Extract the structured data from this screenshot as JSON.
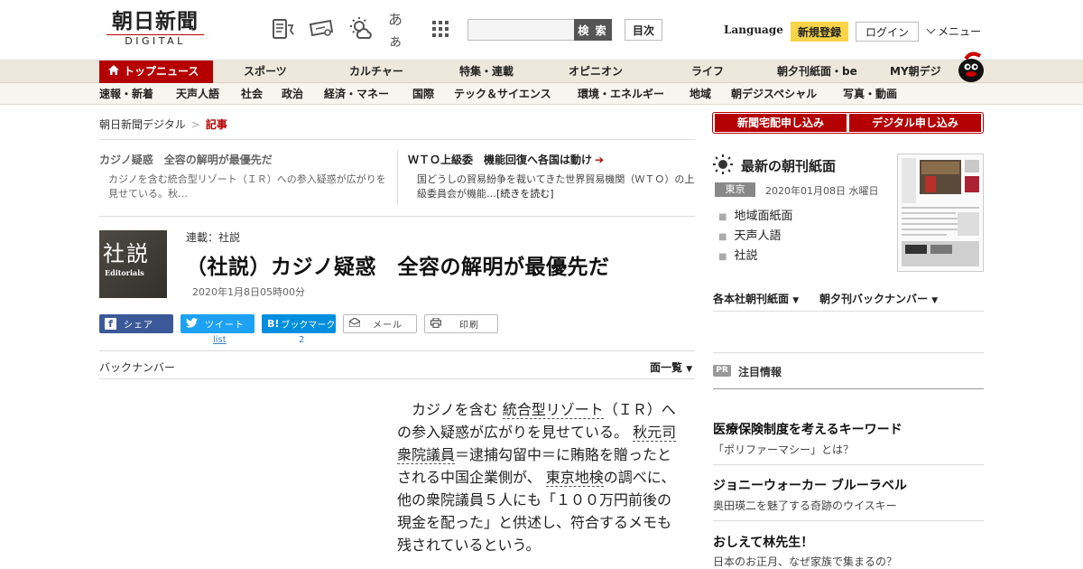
{
  "header": {
    "logo_jp": "朝日新聞",
    "logo_en": "DIGITAL",
    "search_button": "検 索",
    "index_button": "目次",
    "language": "Language",
    "register_button": "新規登録",
    "login_button": "ログイン",
    "menu_button": "メニュー",
    "font_size_label": "あぁ"
  },
  "nav_main": [
    "トップニュース",
    "スポーツ",
    "カルチャー",
    "特集・連載",
    "オピニオン",
    "ライフ",
    "朝夕刊紙面・be",
    "MY朝デジ"
  ],
  "nav_sub": [
    "速報・新着",
    "天声人語",
    "社会",
    "政治",
    "経済・マネー",
    "国際",
    "テック＆サイエンス",
    "環境・エネルギー",
    "地域",
    "朝デジスペシャル",
    "写真・動画"
  ],
  "breadcrumb": {
    "home": "朝日新聞デジタル",
    "sep": ">",
    "current": "記事"
  },
  "related": [
    {
      "title": "カジノ疑惑　全容の解明が最優先だ",
      "body": "カジノを含む統合型リゾート（ＩＲ）への参入疑惑が広がりを見せている。秋…",
      "more": ""
    },
    {
      "title": "ＷＴＯ上級委　機能回復へ各国は動け",
      "body": "国どうしの貿易紛争を裁いてきた世界貿易機関（ＷＴＯ）の上級委員会が機能…",
      "more": "[続きを読む]"
    }
  ],
  "article": {
    "thumb_kanji": "社説",
    "thumb_en": "Editorials",
    "series": "連載：社説",
    "title": "（社説）カジノ疑惑　全容の解明が最優先だ",
    "date": "2020年1月8日05時00分",
    "body_parts": {
      "p1": "カジノを含む",
      "l1": "統合型リゾート",
      "p2": "（ＩＲ）への参入疑惑が広がりを見せている。",
      "l2": "秋元司衆院議員",
      "p3": "＝逮捕勾留中＝に賄賂を贈ったとされる中国企業側が、",
      "l3": "東京地検",
      "p4": "の調べに、他の衆院議員５人にも「１００万円前後の現金を配った」と供述し、符合するメモも残されているという。"
    }
  },
  "share": {
    "facebook": "シェア",
    "twitter": "ツイート",
    "hatena": "ブックマーク",
    "mail": "メール",
    "print": "印刷",
    "twitter_count": "list",
    "hatena_count": "2"
  },
  "backnumber": "バックナンバー",
  "list_button": "面一覧",
  "sidebar": {
    "sub_newspaper": "新聞宅配申し込み",
    "sub_digital": "デジタル申し込み",
    "paper_title": "最新の朝刊紙面",
    "region": "東京",
    "paper_date": "2020年01月08日 水曜日",
    "paper_links": [
      "地域面紙面",
      "天声人語",
      "社説"
    ],
    "dropdown_1": "各本社朝刊紙面",
    "dropdown_2": "朝夕刊バックナンバー",
    "pr_badge": "PR",
    "pr_title": "注目情報",
    "pr_items": [
      {
        "headline": "医療保険制度を考えるキーワード",
        "sub": "「ポリファーマシー」とは？"
      },
      {
        "headline": "ジョニーウォーカー ブルーラベル",
        "sub": "奥田瑛二を魅了する奇跡のウイスキー"
      },
      {
        "headline": "おしえて林先生！",
        "sub": "日本のお正月、なぜ家族で集まるの？"
      }
    ]
  },
  "colors": {
    "brand_red": "#b40000",
    "register_yellow": "#f8d448",
    "facebook": "#3b5998",
    "twitter": "#1da1f2",
    "hatena": "#008fde"
  }
}
